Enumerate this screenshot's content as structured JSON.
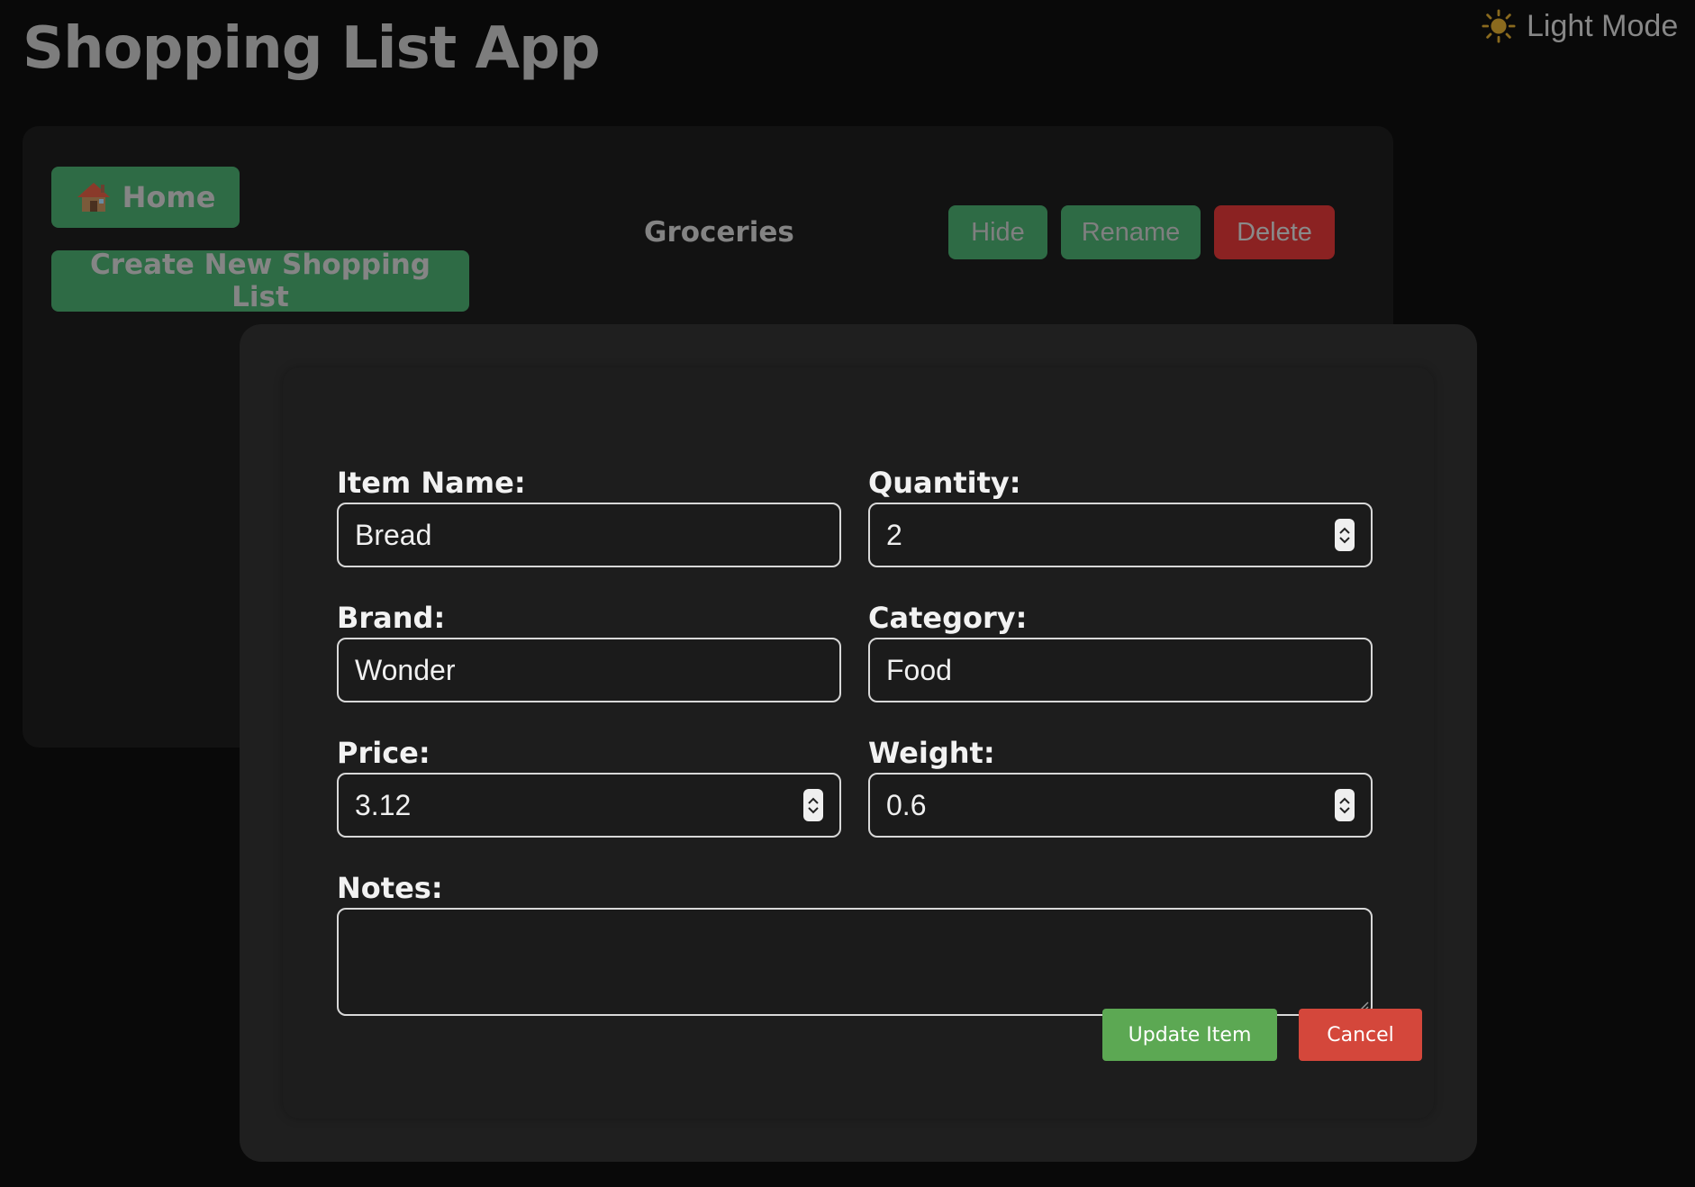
{
  "app": {
    "title": "Shopping List App"
  },
  "theme_toggle": {
    "icon": "sun-icon",
    "label": "Light Mode"
  },
  "sidebar": {
    "home": {
      "icon": "house-icon",
      "label": "Home"
    },
    "create_list_label": "Create New Shopping List"
  },
  "list": {
    "name": "Groceries",
    "actions": {
      "hide": "Hide",
      "rename": "Rename",
      "delete": "Delete"
    }
  },
  "edit_form": {
    "item_name": {
      "label": "Item Name:",
      "value": "Bread"
    },
    "quantity": {
      "label": "Quantity:",
      "value": "2"
    },
    "brand": {
      "label": "Brand:",
      "value": "Wonder"
    },
    "category": {
      "label": "Category:",
      "value": "Food"
    },
    "price": {
      "label": "Price:",
      "value": "3.12"
    },
    "weight": {
      "label": "Weight:",
      "value": "0.6"
    },
    "notes": {
      "label": "Notes:",
      "value": ""
    },
    "update_label": "Update Item",
    "cancel_label": "Cancel"
  },
  "colors": {
    "background": "#090909",
    "panel": "#121212",
    "modal": "#1f1f1f",
    "green_muted": "#2e6b45",
    "red_muted": "#8b2222",
    "update_green": "#5ca853",
    "cancel_red": "#d4473b"
  }
}
